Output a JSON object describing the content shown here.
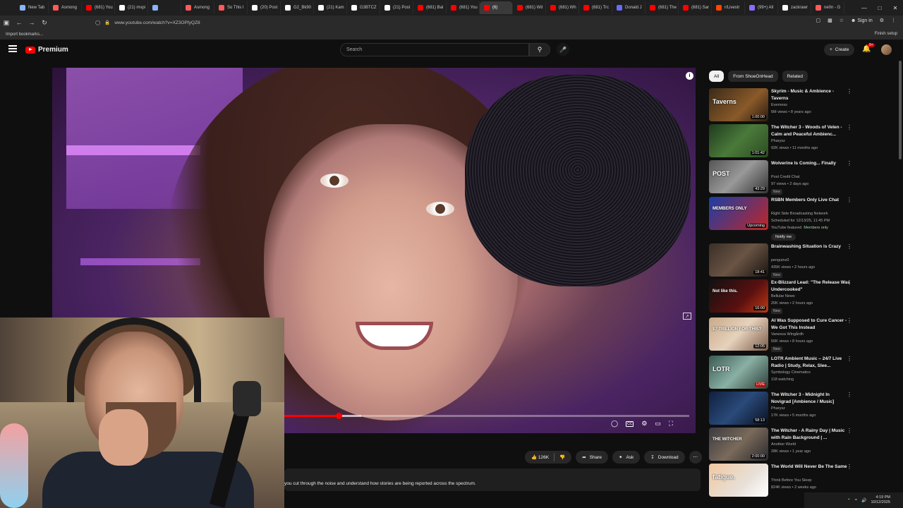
{
  "browser": {
    "tabs": [
      {
        "label": "New Tab",
        "color": "#8ab4f8"
      },
      {
        "label": "Asmong",
        "color": "#ff5a5a"
      },
      {
        "label": "(681) You",
        "color": "#ff0000"
      },
      {
        "label": "(21) mvpi",
        "color": "#ffffff"
      },
      {
        "label": "",
        "color": "#8ab4f8"
      },
      {
        "label": "Asmong",
        "color": "#ff5a5a"
      },
      {
        "label": "So This I",
        "color": "#ff5a5a"
      },
      {
        "label": "(20) Post",
        "color": "#ffffff"
      },
      {
        "label": "G2_Bk90",
        "color": "#ffffff"
      },
      {
        "label": "(21) Kam",
        "color": "#ffffff"
      },
      {
        "label": "G3BTCZ",
        "color": "#ffffff"
      },
      {
        "label": "(21) Post",
        "color": "#ffffff"
      },
      {
        "label": "(681) Bal",
        "color": "#ff0000"
      },
      {
        "label": "(681) You",
        "color": "#ff0000"
      },
      {
        "label": "(6)",
        "color": "#ff0000",
        "active": true
      },
      {
        "label": "(681) Wit",
        "color": "#ff0000"
      },
      {
        "label": "(681) Wh",
        "color": "#ff0000"
      },
      {
        "label": "(681) Trc",
        "color": "#ff0000"
      },
      {
        "label": "Donald J",
        "color": "#6a6aff"
      },
      {
        "label": "(681) The",
        "color": "#ff0000"
      },
      {
        "label": "(681) Sar",
        "color": "#ff0000"
      },
      {
        "label": "r/Livestr",
        "color": "#ff4500"
      },
      {
        "label": "(99+) All",
        "color": "#8c6cff"
      },
      {
        "label": "zackrawr",
        "color": "#ffffff"
      },
      {
        "label": "ne0n - G",
        "color": "#ff5a5a"
      }
    ],
    "url": "www.youtube.com/watch?v=XZ3OPfyQZ8",
    "sign_in": "Sign in",
    "import_bookmarks": "Import bookmarks...",
    "finish_setup": "Finish setup"
  },
  "yt": {
    "brand": "Premium",
    "search_placeholder": "Search",
    "create": "Create",
    "notif_count": "9+"
  },
  "player": {
    "progress": 0.135,
    "buffered": 0.19
  },
  "actions": {
    "likes": "126K",
    "share": "Share",
    "ask": "Ask",
    "download": "Download"
  },
  "description_snippet": "you cut through the noise and understand how stories are being reported across the spectrum.",
  "sidebar": {
    "chips": [
      "All",
      "From ShoeOnHead",
      "Related"
    ],
    "recs": [
      {
        "title": "Skyrim - Music & Ambience - Taverns",
        "channel": "Everness",
        "meta": "6M views • 8 years ago",
        "duration": "1:00:00",
        "thumb_text": "Taverns",
        "thumb": "linear-gradient(135deg,#3a2a18,#8a5a2a 60%,#2a1a10)"
      },
      {
        "title": "The Witcher 3 - Woods of Velen - Calm and Peaceful Ambienc...",
        "channel": "Pharysz",
        "meta": "92K views • 11 months ago",
        "duration": "1:01:42",
        "thumb_text": "",
        "thumb": "linear-gradient(135deg,#1f3a1e,#4a7a3a 50%,#2c4a22)"
      },
      {
        "title": "Wolverine Is Coming... Finally",
        "channel": "Post Credit Chat",
        "meta": "97 views • 2 days ago",
        "duration": "43:29",
        "badge": "New",
        "thumb_text": "POST",
        "thumb": "linear-gradient(135deg,#555,#999 50%,#333)"
      },
      {
        "title": "RSBN Members Only Live Chat",
        "channel": "Right Side Broadcasting Network",
        "meta": "Scheduled for 12/13/25, 11:45 PM",
        "extra": "YouTube featured",
        "members": "Members only",
        "duration": "Upcoming",
        "notify": "Notify me",
        "thumb_text": "MEMBERS ONLY",
        "thumb": "linear-gradient(135deg,#1a3ea8,#c02626)"
      },
      {
        "title": "Brainwashing Situation is Crazy",
        "channel": "penguinz0",
        "meta": "435K views • 2 hours ago",
        "duration": "18:41",
        "badge": "New",
        "thumb_text": "",
        "thumb": "linear-gradient(135deg,#3a2e26,#6a5444 50%,#1a1410)"
      },
      {
        "title": "Ex-Blizzard Lead: \"The Release Was Undercooked\"",
        "channel": "Bellular News",
        "meta": "20K views • 2 hours ago",
        "duration": "16:00",
        "badge": "New",
        "thumb_text": "Not like this.",
        "thumb": "linear-gradient(135deg,#111,#5a1010 60%,#c03a10)"
      },
      {
        "title": "AI Was Supposed to Cure Cancer - We Got This Instead",
        "channel": "Vanessa Wingårdh",
        "meta": "50K views • 8 hours ago",
        "duration": "12:05",
        "badge": "New",
        "thumb_text": "$7 TRILLION FOR THIS?",
        "thumb": "linear-gradient(135deg,#c9a888,#e6d2bc 50%,#7a5a48)"
      },
      {
        "title": "LOTR Ambient Music – 24/7 Live Radio | Study, Relax, Slee...",
        "channel": "Symbology Cinematics",
        "meta": "118 watching",
        "duration": "LIVE",
        "thumb_text": "LOTR",
        "thumb": "linear-gradient(135deg,#3a5a52,#8ab0a4 50%,#2a3e38)"
      },
      {
        "title": "The Witcher 3 - Midnight In Novigrad [Ambience / Music]",
        "channel": "Pharysz",
        "meta": "17K views • 5 months ago",
        "duration": "58:13",
        "thumb_text": "",
        "thumb": "linear-gradient(135deg,#102040,#2a4a7a 50%,#0a1020)"
      },
      {
        "title": "The Witcher - A Rainy Day | Music with Rain Background | ...",
        "channel": "Another World",
        "meta": "28K views • 1 year ago",
        "duration": "2:00:00",
        "thumb_text": "THE WITCHER",
        "thumb": "linear-gradient(135deg,#3a3a40,#7a6a5a 50%,#2a2a2e)"
      },
      {
        "title": "The World Will Never Be The Same",
        "channel": "Think Before You Sleep",
        "meta": "824K views • 2 weeks ago",
        "duration": "",
        "thumb_text": "fatigue.",
        "thumb": "linear-gradient(135deg,#f0c8a0,#e8e0d8 60%,#fff)"
      }
    ]
  },
  "taskbar": {
    "time": "4:19 PM",
    "date": "10/12/2025"
  }
}
